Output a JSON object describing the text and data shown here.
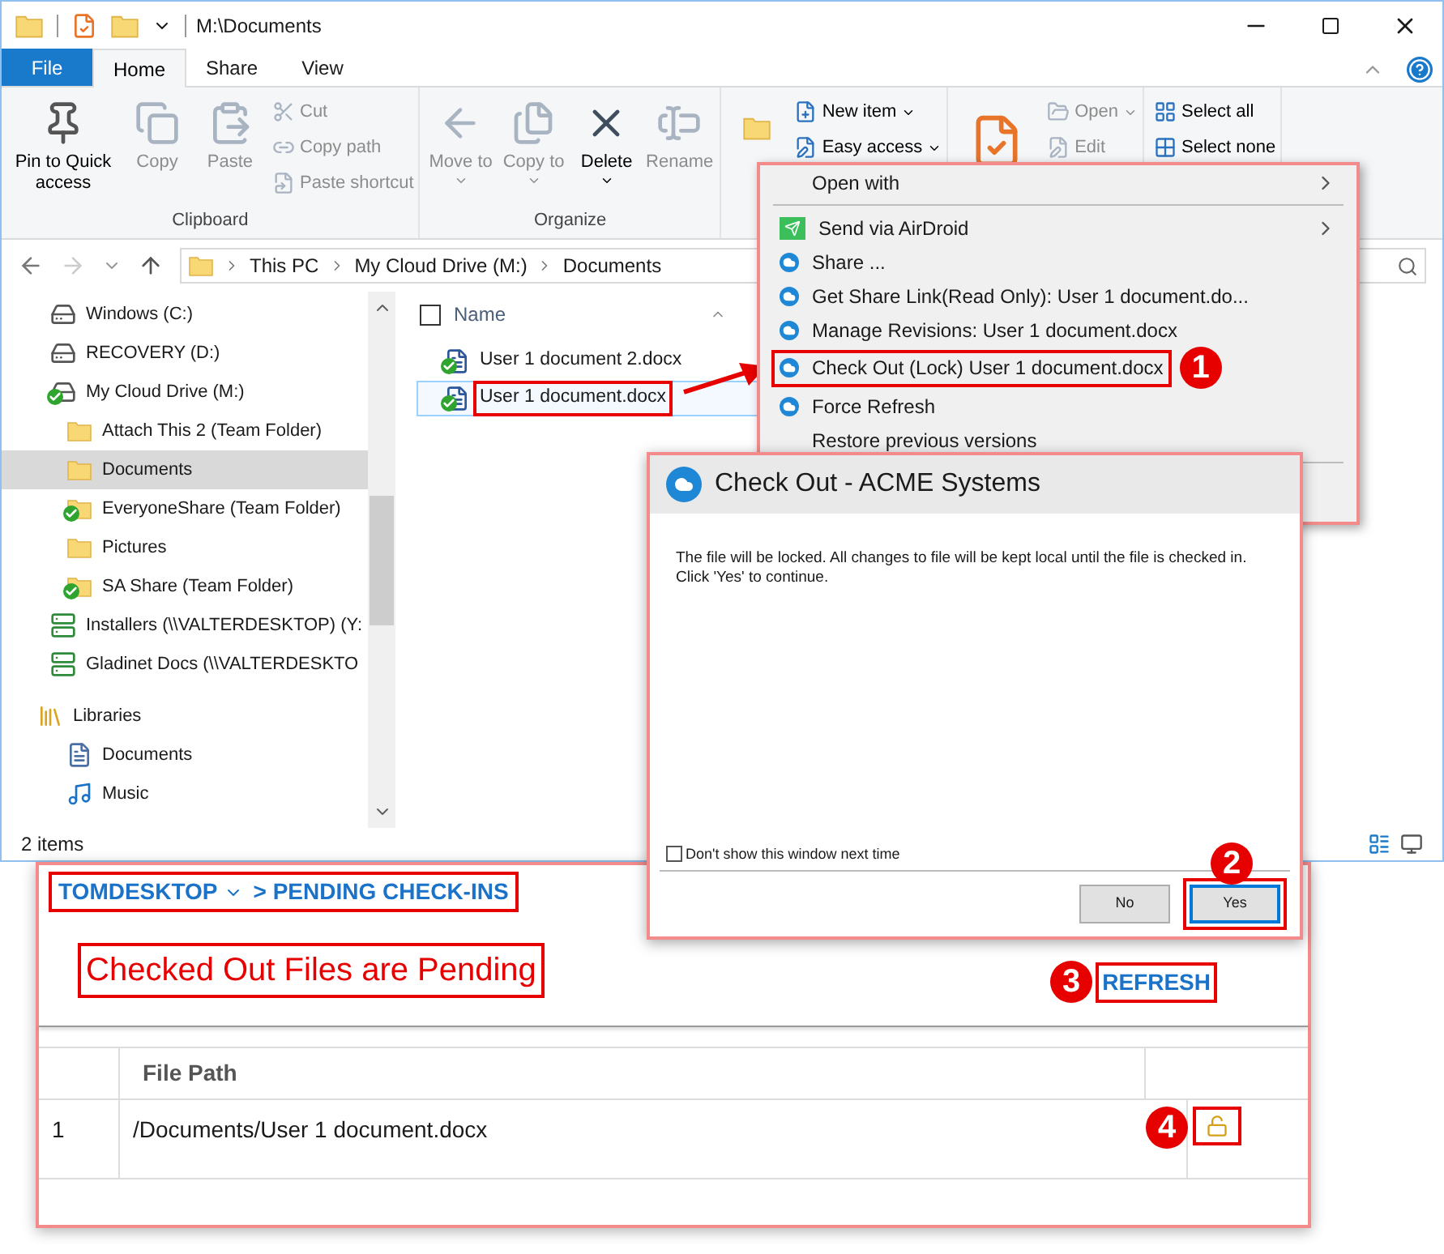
{
  "window": {
    "title": "M:\\Documents"
  },
  "ribbon_tabs": [
    {
      "label": "File",
      "kind": "file",
      "selected": false
    },
    {
      "label": "Home",
      "kind": "tab",
      "selected": true
    },
    {
      "label": "Share",
      "kind": "tab",
      "selected": false
    },
    {
      "label": "View",
      "kind": "tab",
      "selected": false
    }
  ],
  "ribbon_groups": [
    {
      "label": "Clipboard",
      "items": [
        {
          "label": "Pin to Quick access",
          "kind": "large",
          "disabled": false
        },
        {
          "label": "Copy",
          "kind": "large",
          "disabled": true
        },
        {
          "label": "Paste",
          "kind": "large",
          "disabled": true
        },
        {
          "label": "Cut",
          "kind": "small",
          "disabled": true
        },
        {
          "label": "Copy path",
          "kind": "small",
          "disabled": true
        },
        {
          "label": "Paste shortcut",
          "kind": "small",
          "disabled": true
        }
      ]
    },
    {
      "label": "Organize",
      "items": [
        {
          "label": "Move to",
          "kind": "large",
          "disabled": true,
          "dropdown": true
        },
        {
          "label": "Copy to",
          "kind": "large",
          "disabled": true,
          "dropdown": true
        },
        {
          "label": "Delete",
          "kind": "large",
          "disabled": false,
          "dropdown": true
        },
        {
          "label": "Rename",
          "kind": "large",
          "disabled": true
        }
      ]
    },
    {
      "items": [
        {
          "kind": "large"
        },
        {
          "label": "New item",
          "kind": "small",
          "disabled": false,
          "dropdown": true
        },
        {
          "label": "Easy access",
          "kind": "small",
          "disabled": false,
          "dropdown": true
        }
      ]
    },
    {
      "items": [
        {
          "kind": "large"
        },
        {
          "label": "Open",
          "kind": "small",
          "disabled": true,
          "dropdown": true
        },
        {
          "label": "Edit",
          "kind": "small",
          "disabled": true
        }
      ]
    },
    {
      "items": [
        {
          "label": "Select all",
          "kind": "small",
          "disabled": false
        },
        {
          "label": "Select none",
          "kind": "small",
          "disabled": false
        }
      ]
    }
  ],
  "address": {
    "breadcrumbs": [
      "This PC",
      "My Cloud Drive (M:)",
      "Documents"
    ]
  },
  "navigation": [
    {
      "label": "Windows (C:)",
      "kind": "system-drive",
      "synced": false,
      "selected": false
    },
    {
      "label": "RECOVERY (D:)",
      "kind": "drive",
      "synced": false,
      "selected": false
    },
    {
      "label": "My Cloud Drive (M:)",
      "kind": "drive",
      "synced": true,
      "selected": false,
      "children": [
        {
          "label": "Attach This 2 (Team Folder)",
          "kind": "folder",
          "synced": false,
          "selected": false
        },
        {
          "label": "Documents",
          "kind": "folder",
          "synced": false,
          "selected": true
        },
        {
          "label": "EveryoneShare (Team Folder)",
          "kind": "folder",
          "synced": true,
          "selected": false
        },
        {
          "label": "Pictures",
          "kind": "folder",
          "synced": false,
          "selected": false
        },
        {
          "label": "SA Share (Team Folder)",
          "kind": "folder",
          "synced": true,
          "selected": false
        }
      ]
    },
    {
      "label": "Installers (\\\\VALTERDESKTOP) (Y:",
      "kind": "network-drive",
      "synced": false,
      "selected": false
    },
    {
      "label": "Gladinet Docs (\\\\VALTERDESKTO",
      "kind": "network-drive",
      "synced": false,
      "selected": false
    },
    {
      "label": "Libraries",
      "kind": "library",
      "synced": false,
      "selected": false,
      "children": [
        {
          "label": "Documents",
          "kind": "documents",
          "synced": false,
          "selected": false
        },
        {
          "label": "Music",
          "kind": "music",
          "synced": false,
          "selected": false
        }
      ]
    }
  ],
  "file_list": {
    "select_all": {
      "checked": false
    },
    "columns": [
      "Name"
    ],
    "files": [
      {
        "name": "User 1 document 2.docx",
        "selected": false,
        "marked": false
      },
      {
        "name": "User 1 document.docx",
        "selected": true,
        "marked": true
      }
    ]
  },
  "status_bar": {
    "text": "2 items"
  },
  "context_menu": {
    "items": [
      {
        "label": "Open with",
        "kind": "plain",
        "submenu": true,
        "separator_after": true,
        "marked": false
      },
      {
        "label": "Send via AirDroid",
        "kind": "airdroid",
        "submenu": true,
        "separator_after": false,
        "marked": false
      },
      {
        "label": "Share ...",
        "kind": "cloud",
        "submenu": false,
        "separator_after": false,
        "marked": false
      },
      {
        "label": "Get Share Link(Read Only): User 1 document.do...",
        "kind": "cloud",
        "submenu": false,
        "separator_after": false,
        "marked": false
      },
      {
        "label": "Manage Revisions: User 1 document.docx",
        "kind": "cloud",
        "submenu": false,
        "separator_after": false,
        "marked": false
      },
      {
        "label": "Check Out (Lock) User 1 document.docx",
        "kind": "cloud",
        "submenu": false,
        "separator_after": false,
        "marked": true,
        "callout": "1"
      },
      {
        "label": "Force Refresh",
        "kind": "cloud",
        "submenu": false,
        "separator_after": false,
        "marked": false
      },
      {
        "label": "Restore previous versions",
        "kind": "plain",
        "submenu": false,
        "separator_after": true,
        "marked": false
      }
    ]
  },
  "dialog": {
    "title": "Check Out - ACME Systems",
    "message": "The file will be locked. All changes to file will be kept local until the file is checked in. Click 'Yes' to continue.",
    "checkbox": {
      "label": "Don't show this window next time",
      "checked": false
    },
    "buttons": [
      {
        "label": "No",
        "default": false,
        "marked": false
      },
      {
        "label": "Yes",
        "default": true,
        "marked": true,
        "callout": "2"
      }
    ]
  },
  "pending_panel": {
    "breadcrumb": {
      "machine": "TOMDESKTOP",
      "page": "> PENDING CHECK-INS"
    },
    "heading": "Checked Out Files are Pending",
    "refresh": {
      "label": "REFRESH",
      "callout": "3"
    },
    "table": {
      "columns": [
        "File Path"
      ],
      "rows": [
        {
          "number": "1",
          "file_path": "/Documents/User 1 document.docx",
          "locked": false,
          "callout": "4"
        }
      ]
    }
  }
}
